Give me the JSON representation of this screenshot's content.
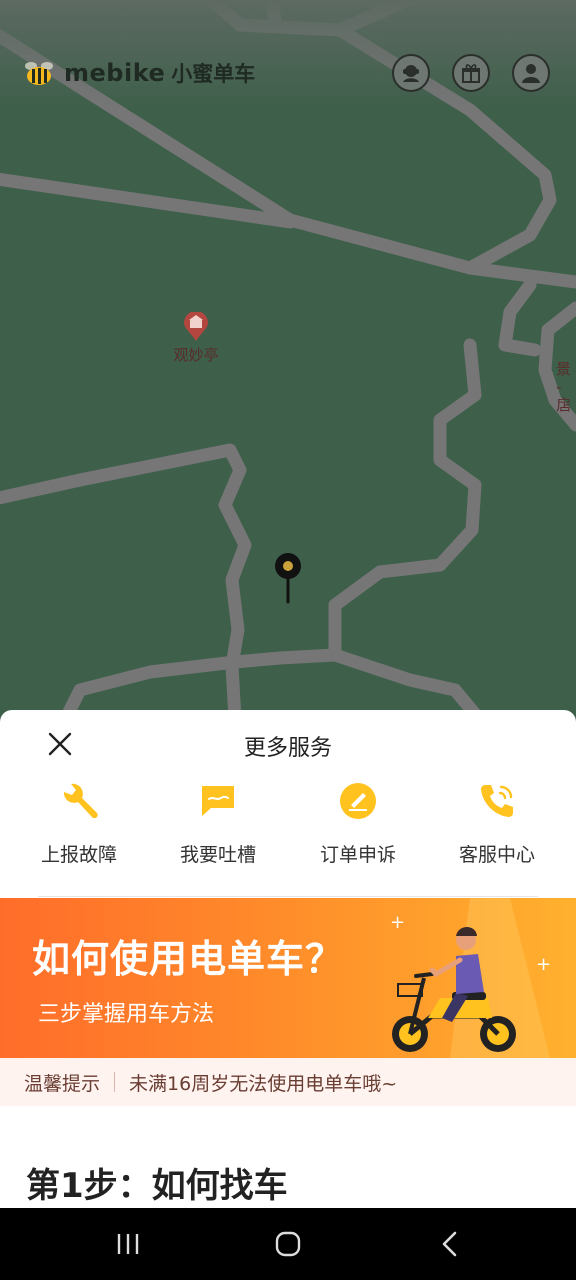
{
  "header": {
    "brand_latin": "mebike",
    "brand_cn": "小蜜单车",
    "buttons": [
      {
        "icon": "support-agent-icon"
      },
      {
        "icon": "gift-icon"
      },
      {
        "icon": "user-icon"
      }
    ]
  },
  "map": {
    "poi_label": "观妙亭",
    "edge_label_line1": "景",
    "edge_label_line2": "-扂"
  },
  "sheet": {
    "title": "更多服务",
    "close_icon": "close-icon",
    "services": [
      {
        "label": "上报故障",
        "icon": "wrench-icon"
      },
      {
        "label": "我要吐槽",
        "icon": "chat-bubble-icon"
      },
      {
        "label": "订单申诉",
        "icon": "edit-pen-icon"
      },
      {
        "label": "客服中心",
        "icon": "phone-icon"
      }
    ],
    "accent_color": "#ffc21f",
    "banner": {
      "title": "如何使用电单车？",
      "subtitle": "三步掌握用车方法"
    },
    "tip": {
      "label": "温馨提示",
      "text": "未满16周岁无法使用电单车哦~"
    },
    "step_heading": "第1步：如何找车"
  }
}
